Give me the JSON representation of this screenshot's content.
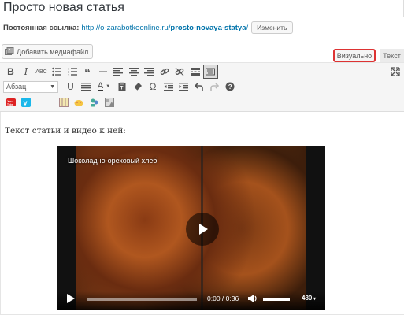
{
  "post": {
    "title": "Просто новая статья"
  },
  "permalink": {
    "label": "Постоянная ссылка:",
    "url_base": "http://o-zarabotkeonline.ru/",
    "slug": "prosto-novaya-statya",
    "url_end": "/",
    "edit_label": "Изменить"
  },
  "media": {
    "add_label": "Добавить медиафайл"
  },
  "tabs": {
    "visual": "Визуально",
    "text": "Текст"
  },
  "toolbar": {
    "row1": [
      "B",
      "I",
      "ABC",
      "ul",
      "ol",
      "quote",
      "hr",
      "align-left",
      "align-center",
      "align-right",
      "link",
      "unlink",
      "more",
      "fullwidth",
      "kitchen-sink",
      "fullscreen"
    ],
    "format_select": "Абзац",
    "row2": [
      "underline",
      "justify",
      "text-color",
      "paste-text",
      "clear-format",
      "special-char",
      "outdent",
      "indent",
      "undo",
      "redo",
      "help"
    ]
  },
  "content": {
    "text": "Текст статьи и видео к ней:"
  },
  "video": {
    "title": "Шоколадно-ореховый хлеб",
    "time": "0:00 / 0:36",
    "quality": "480",
    "brand": "VK"
  }
}
